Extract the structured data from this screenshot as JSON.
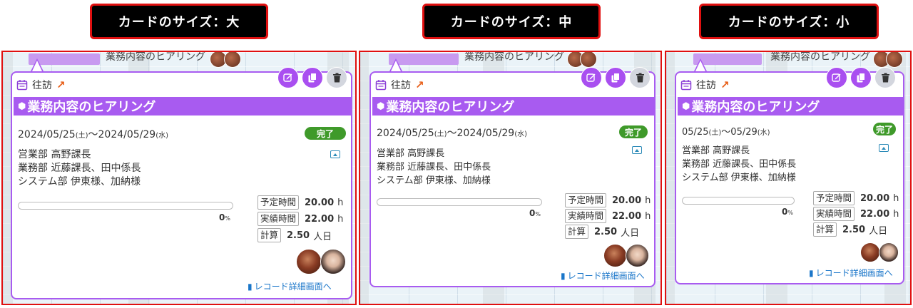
{
  "labels": {
    "large": "カードのサイズ：大",
    "medium": "カードのサイズ：中",
    "small": "カードのサイズ：小"
  },
  "background": {
    "event_title": "業務内容のヒアリング"
  },
  "card": {
    "type_label": "往訪",
    "title": "業務内容のヒアリング",
    "date_full_start": "2024/05/25",
    "date_full_end": "2024/05/29",
    "date_short_start": "05/25",
    "date_short_end": "05/29",
    "start_weekday": "(土)",
    "end_weekday": "(水)",
    "date_separator": "～",
    "status": "完了",
    "members": [
      "営業部 高野課長",
      "業務部 近藤課長、田中係長",
      "システム部 伊東様、加納様"
    ],
    "progress": 0,
    "progress_value": "0",
    "progress_unit": "%",
    "planned_label": "予定時間",
    "planned_value": "20.00",
    "planned_unit": "h",
    "actual_label": "実績時間",
    "actual_value": "22.00",
    "actual_unit": "h",
    "calc_label": "計算",
    "calc_value": "2.50",
    "calc_unit": "人日",
    "record_link": "レコード詳細画面へ"
  },
  "icons": {
    "type": "calendar-icon",
    "external": "external-link-arrow-icon",
    "edit": "edit-icon",
    "copy": "copy-icon",
    "delete": "trash-icon",
    "title": "cube-icon",
    "collapse": "collapse-up-icon",
    "link": "document-icon"
  },
  "colors": {
    "accent": "#a85bf0",
    "status": "#3f9a2a",
    "frame": "#e01010",
    "link": "#1a76c9"
  }
}
